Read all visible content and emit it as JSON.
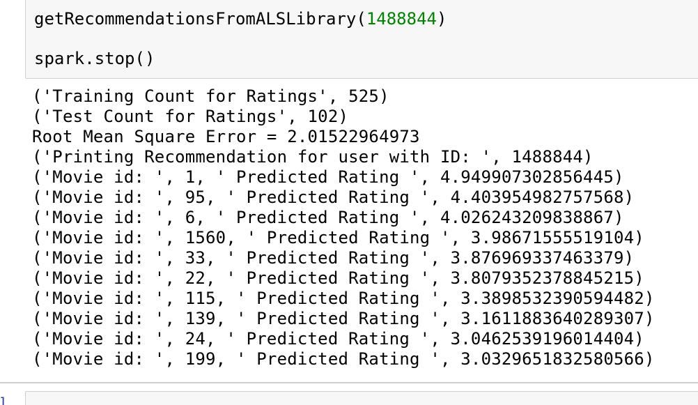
{
  "input_cell": {
    "line1_func": "getRecommendationsFromALSLibrary(",
    "line1_arg": "1488844",
    "line1_close": ")",
    "line2": "spark.stop()"
  },
  "output_cell": {
    "lines": [
      "('Training Count for Ratings', 525)",
      "('Test Count for Ratings', 102)",
      "Root Mean Square Error = 2.01522964973",
      "('Printing Recommendation for user with ID: ', 1488844)",
      "('Movie id: ', 1, ' Predicted Rating ', 4.949907302856445)",
      "('Movie id: ', 95, ' Predicted Rating ', 4.403954982757568)",
      "('Movie id: ', 6, ' Predicted Rating ', 4.026243209838867)",
      "('Movie id: ', 1560, ' Predicted Rating ', 3.98671555519104)",
      "('Movie id: ', 33, ' Predicted Rating ', 3.876969337463379)",
      "('Movie id: ', 22, ' Predicted Rating ', 3.8079352378845215)",
      "('Movie id: ', 115, ' Predicted Rating ', 3.3898532390594482)",
      "('Movie id: ', 139, ' Predicted Rating ', 3.1611883640289307)",
      "('Movie id: ', 24, ' Predicted Rating ', 3.0462539196014404)",
      "('Movie id: ', 199, ' Predicted Rating ', 3.0329651832580566)"
    ]
  },
  "next_cell": {
    "prompt": "]"
  },
  "colors": {
    "number_literal": "#008000",
    "cell_background": "#f7f7f7",
    "cell_border": "#cfcfcf"
  }
}
